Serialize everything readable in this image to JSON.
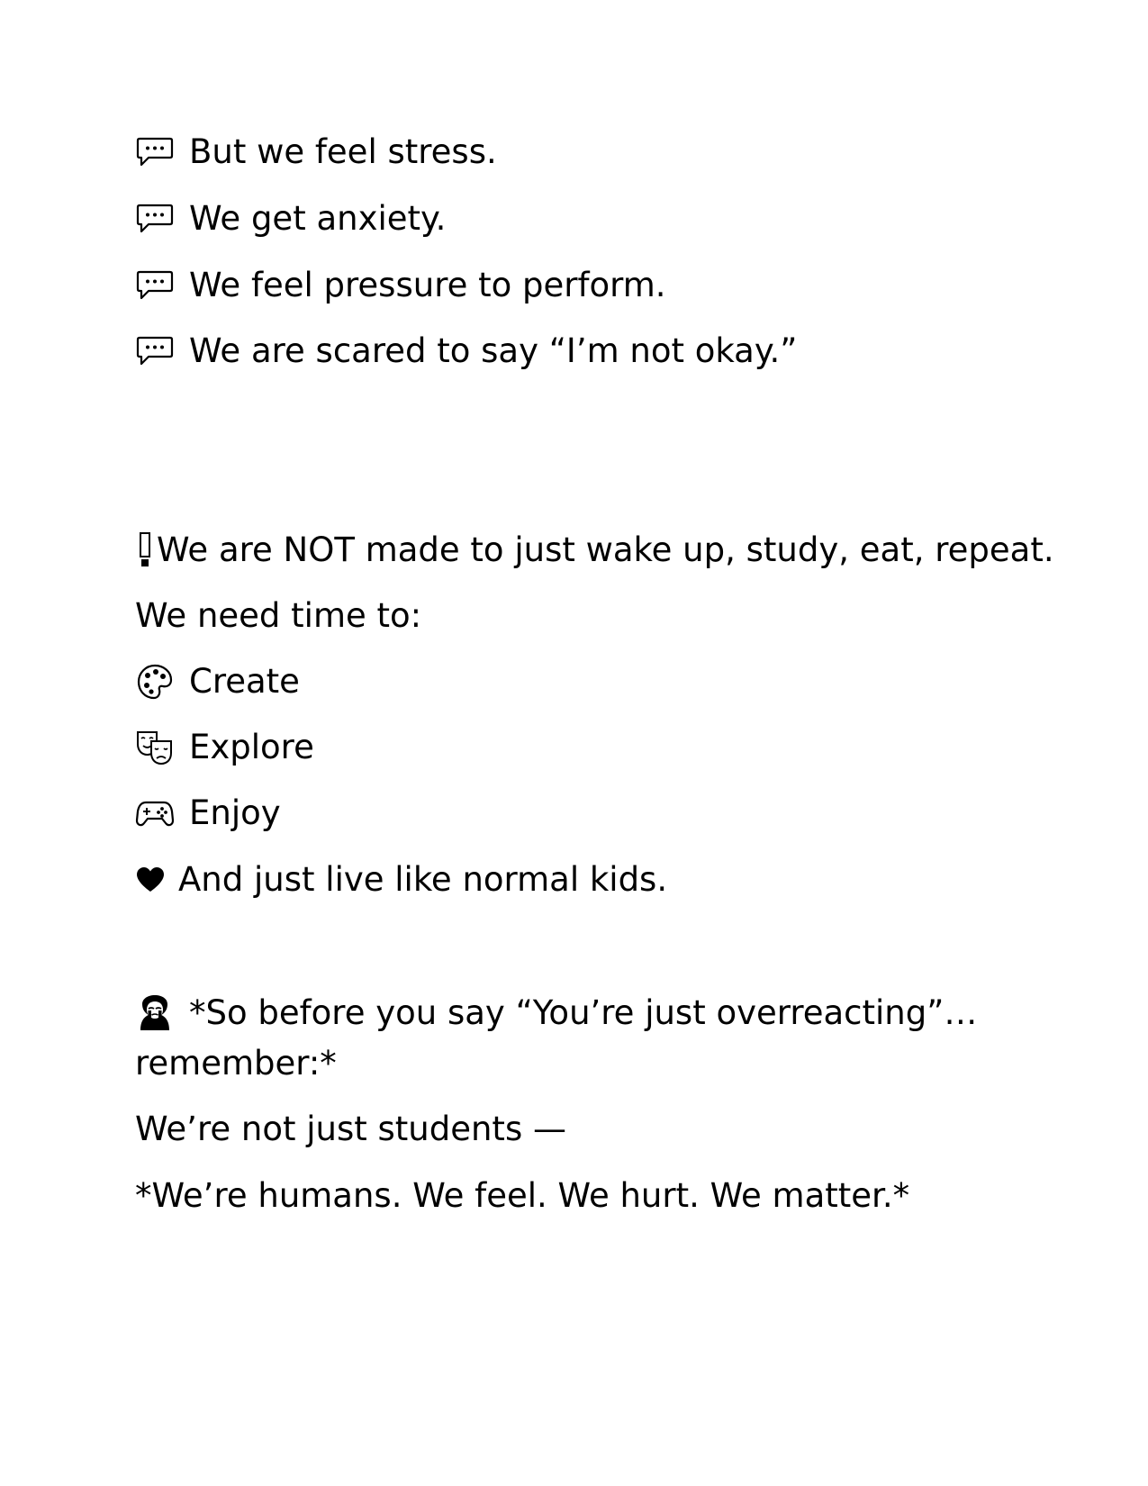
{
  "document": {
    "block1": {
      "lines": [
        {
          "icon": "speech-bubble-icon",
          "text": "But we feel stress."
        },
        {
          "icon": "speech-bubble-icon",
          "text": "We get anxiety."
        },
        {
          "icon": "speech-bubble-icon",
          "text": "We feel pressure to perform."
        },
        {
          "icon": "speech-bubble-icon",
          "text": "We are scared to say “I’m not okay.”"
        }
      ]
    },
    "block2": {
      "headline_icon": "exclamation-icon",
      "headline": "We are NOT made to just wake up, study, eat, repeat.",
      "intro": "We need time to:",
      "items": [
        {
          "icon": "palette-icon",
          "text": "Create"
        },
        {
          "icon": "theater-masks-icon",
          "text": "Explore"
        },
        {
          "icon": "game-controller-icon",
          "text": "Enjoy"
        },
        {
          "icon": "heart-icon",
          "text": "And just live like normal kids."
        }
      ]
    },
    "block3": {
      "icon": "crying-person-icon",
      "line1": "*So before you say “You’re just overreacting”…",
      "line2": "remember:*",
      "line3": "We’re not just students —",
      "line4": "*We’re humans. We feel. We hurt. We matter.*"
    }
  }
}
